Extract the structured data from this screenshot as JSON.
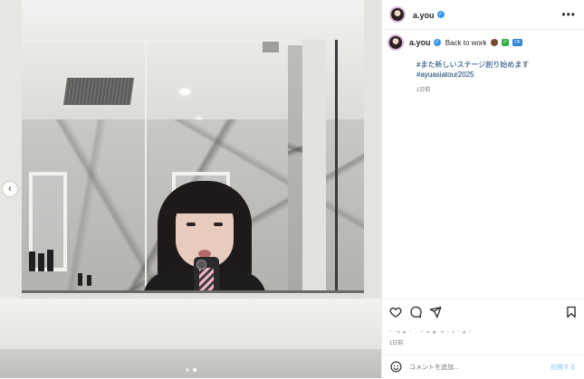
{
  "post": {
    "username": "a.you",
    "verified_icon": "verified-badge-icon",
    "more_icon": "more-options-icon",
    "caption": {
      "author": "a.you",
      "first_line": "Back to work",
      "emojis": [
        "brown-circle-emoji",
        "green-check-emoji",
        "blue-ok-emoji"
      ],
      "ok_text": "OK",
      "line2": "#また新しいステージ創り始めます",
      "line3": "#ayuasiatour2025",
      "time": "1日前"
    },
    "likes_text": "· ·ᵣ ₒ · ˙ · ₌ ₐ ·ᵣ · ᵢ · ₒ ·",
    "time": "1日前",
    "comment_placeholder": "コメントを追加...",
    "post_button": "投稿する",
    "carousel": {
      "count": 2,
      "active_index": 1
    }
  },
  "colors": {
    "link": "#00376b",
    "verified": "#3897f0",
    "post_button": "#b3dbff"
  }
}
